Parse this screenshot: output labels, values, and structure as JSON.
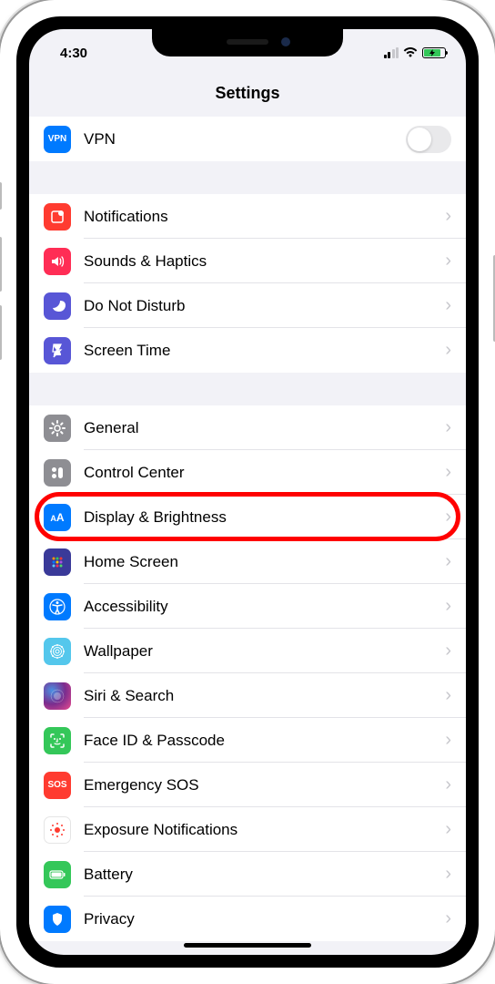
{
  "status": {
    "time": "4:30"
  },
  "header": {
    "title": "Settings"
  },
  "section1": {
    "vpn": "VPN"
  },
  "section2": {
    "notifications": "Notifications",
    "sounds": "Sounds & Haptics",
    "dnd": "Do Not Disturb",
    "screentime": "Screen Time"
  },
  "section3": {
    "general": "General",
    "controlcenter": "Control Center",
    "display": "Display & Brightness",
    "homescreen": "Home Screen",
    "accessibility": "Accessibility",
    "wallpaper": "Wallpaper",
    "siri": "Siri & Search",
    "faceid": "Face ID & Passcode",
    "sos": "Emergency SOS",
    "exposure": "Exposure Notifications",
    "battery": "Battery",
    "privacy": "Privacy"
  },
  "icons": {
    "vpn_text": "VPN",
    "display_text": "AA",
    "sos_text": "SOS"
  }
}
